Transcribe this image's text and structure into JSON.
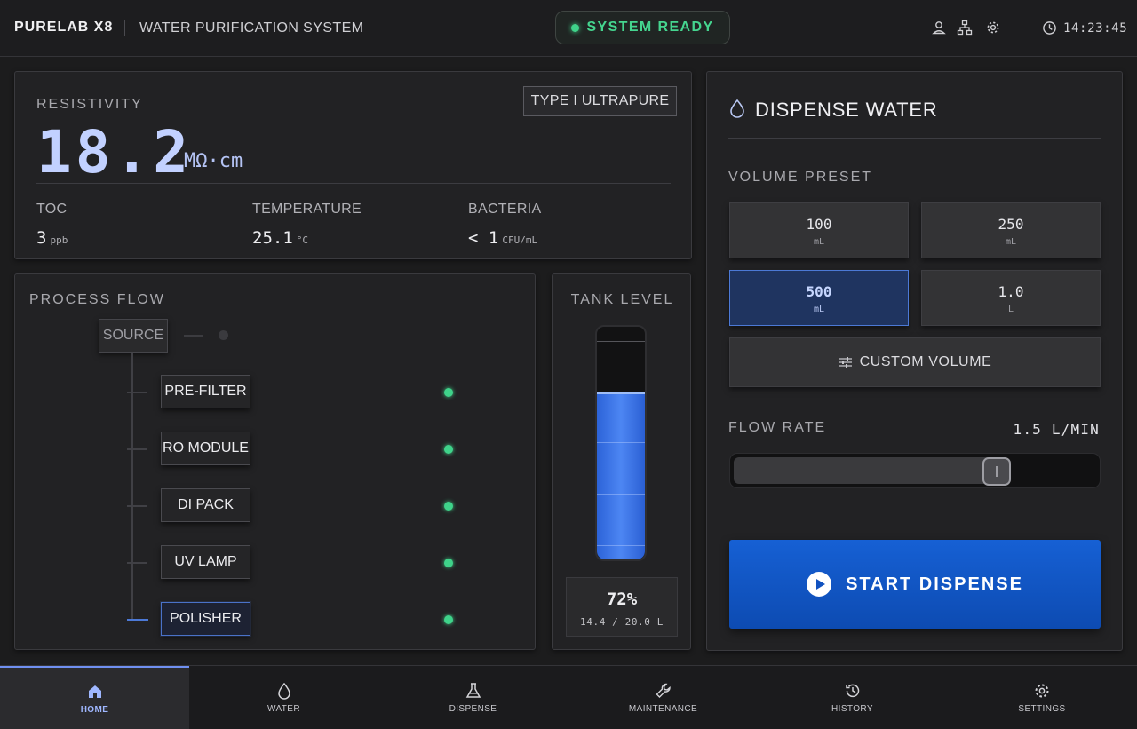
{
  "header": {
    "brand": "PURELAB X8",
    "subtitle": "WATER PURIFICATION SYSTEM",
    "status": "SYSTEM READY",
    "time": "14:23:45",
    "icons": [
      "user-icon",
      "network-icon",
      "gear-icon",
      "clock-icon"
    ]
  },
  "resistivity": {
    "label": "RESISTIVITY",
    "badge": "TYPE I ULTRAPURE",
    "value": "18.2",
    "unit": "MΩ·cm",
    "metrics": [
      {
        "label": "TOC",
        "value": "3",
        "unit": "ppb"
      },
      {
        "label": "TEMPERATURE",
        "value": "25.1",
        "unit": "°C"
      },
      {
        "label": "BACTERIA",
        "value": "< 1",
        "unit": "CFU/mL"
      }
    ]
  },
  "process": {
    "title": "PROCESS FLOW",
    "source": "SOURCE",
    "stages": [
      {
        "name": "PRE-FILTER",
        "status": "ok"
      },
      {
        "name": "RO MODULE",
        "status": "ok"
      },
      {
        "name": "DI PACK",
        "status": "ok"
      },
      {
        "name": "UV LAMP",
        "status": "ok"
      },
      {
        "name": "POLISHER",
        "status": "ok",
        "active": true
      }
    ]
  },
  "tank": {
    "title": "TANK LEVEL",
    "level": 0.72,
    "percent": "72%",
    "volume": "14.4 / 20.0 L"
  },
  "dispense": {
    "title": "DISPENSE WATER",
    "preset_label": "VOLUME PRESET",
    "presets": [
      {
        "value": "100",
        "unit": "mL"
      },
      {
        "value": "250",
        "unit": "mL"
      },
      {
        "value": "500",
        "unit": "mL",
        "selected": true
      },
      {
        "value": "1.0",
        "unit": "L"
      }
    ],
    "custom_label": "CUSTOM VOLUME",
    "flow_label": "FLOW RATE",
    "flow_value": "1.5 L/MIN",
    "flow_fraction": 0.72,
    "start_label": "START DISPENSE"
  },
  "nav": [
    {
      "label": "HOME",
      "icon": "home-icon",
      "active": true
    },
    {
      "label": "WATER",
      "icon": "droplet-icon"
    },
    {
      "label": "DISPENSE",
      "icon": "flask-icon"
    },
    {
      "label": "MAINTENANCE",
      "icon": "wrench-icon"
    },
    {
      "label": "HISTORY",
      "icon": "history-icon"
    },
    {
      "label": "SETTINGS",
      "icon": "gear-icon"
    }
  ],
  "colors": {
    "accent": "#6f8ff0",
    "status_green": "#3fd38a",
    "primary_button": "#1660d4",
    "value_blue": "#c2d1ff"
  }
}
